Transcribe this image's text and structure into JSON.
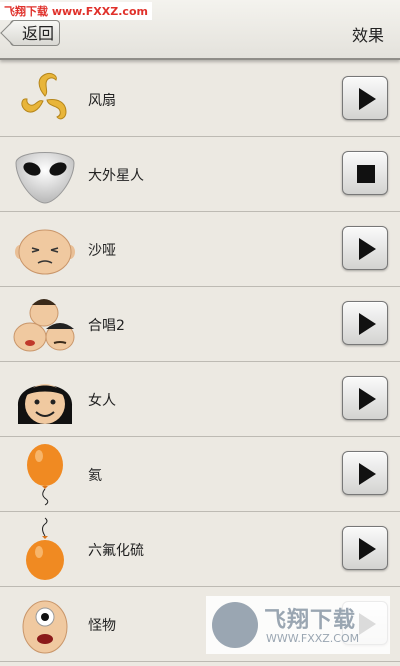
{
  "watermark_top": "飞翔下载 www.FXXZ.com",
  "header": {
    "back_label": "返回",
    "title": "效果"
  },
  "effects": [
    {
      "label": "风扇",
      "icon": "fan-icon",
      "state": "play"
    },
    {
      "label": "大外星人",
      "icon": "alien-icon",
      "state": "stop"
    },
    {
      "label": "沙哑",
      "icon": "hoarse-face-icon",
      "state": "play"
    },
    {
      "label": "合唱2",
      "icon": "chorus-faces-icon",
      "state": "play"
    },
    {
      "label": "女人",
      "icon": "woman-face-icon",
      "state": "play"
    },
    {
      "label": "氦",
      "icon": "helium-balloon-icon",
      "state": "play"
    },
    {
      "label": "六氟化硫",
      "icon": "sf6-balloon-icon",
      "state": "play"
    },
    {
      "label": "怪物",
      "icon": "monster-icon",
      "state": "play"
    }
  ],
  "watermark_bottom": {
    "main": "飞翔下载",
    "url": "WWW.FXXZ.COM"
  }
}
